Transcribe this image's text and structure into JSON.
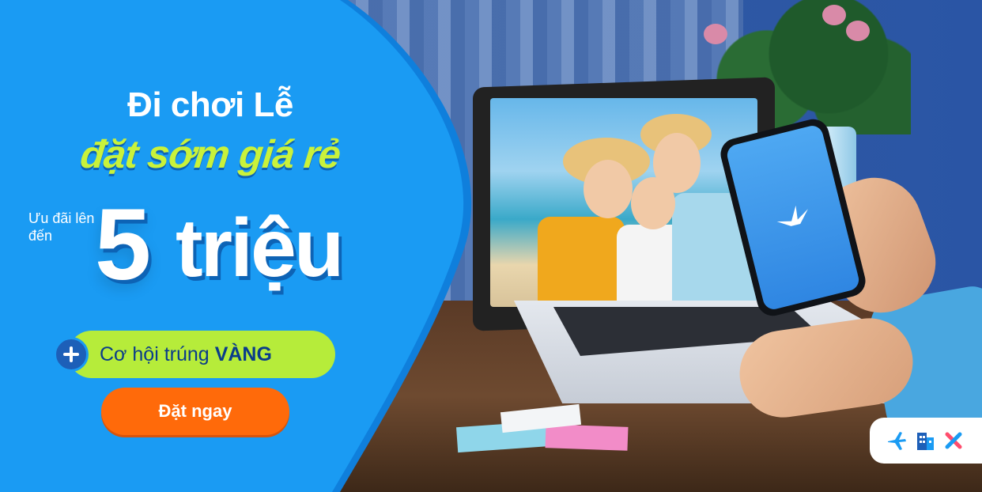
{
  "banner": {
    "headline_line1": "Đi chơi Lễ",
    "headline_line2": "đặt sớm giá rẻ",
    "offer_label": "Ưu đãi lên đến",
    "offer_amount": "5",
    "offer_unit": "triệu",
    "gold_text": "Cơ hội trúng",
    "gold_emphasis": "VÀNG",
    "cta_label": "Đặt ngay"
  },
  "services": {
    "icons": [
      "airplane-icon",
      "hotel-icon",
      "activities-icon"
    ]
  },
  "colors": {
    "panel_blue": "#1a9bf3",
    "accent_green": "#b6ec3a",
    "cta_orange": "#ff6a0a",
    "dark_blue": "#0a3c8a"
  }
}
